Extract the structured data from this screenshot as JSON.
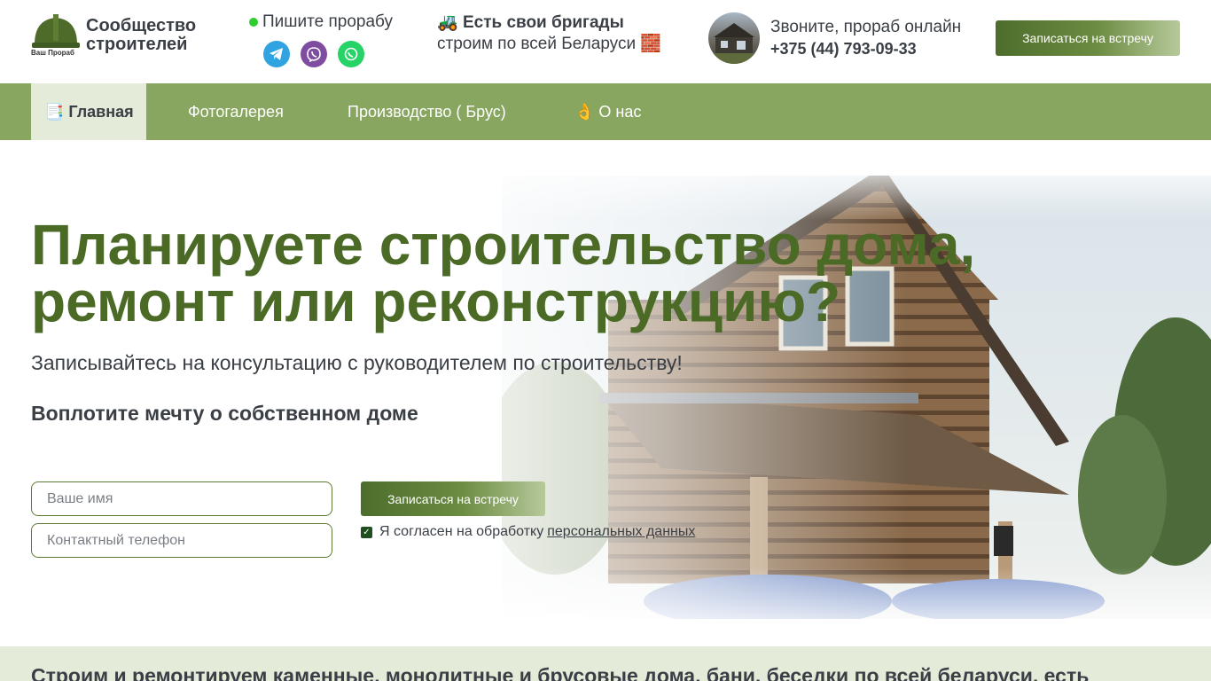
{
  "header": {
    "logo_caption": "Ваш Прораб",
    "brand_line1": "Сообщество",
    "brand_line2": "строителей",
    "write_label": "Пишите прорабу",
    "brigades_bold": "Есть свои бригады",
    "brigades_text": "строим по всей Беларуси",
    "call_label": "Звоните, прораб онлайн",
    "call_phone": "+375 (44) 793-09-33",
    "cta_label": "Записаться на встречу"
  },
  "nav": {
    "items": [
      {
        "label": "Главная",
        "emoji": "📑"
      },
      {
        "label": "Фотогалерея"
      },
      {
        "label": "Производство ( Брус)"
      },
      {
        "label": "О нас",
        "emoji": "👌"
      }
    ]
  },
  "hero": {
    "title": "Планируете строительство дома, ремонт или реконструкцию?",
    "subtitle": "Записывайтесь на консультацию с руководителем по строительству!",
    "dream": "Воплотите мечту о собственном доме",
    "name_placeholder": "Ваше имя",
    "phone_placeholder": "Контактный телефон",
    "cta_label": "Записаться на встречу",
    "agree_text": "Я согласен на обработку",
    "agree_link": "персональных данных"
  },
  "bottom": {
    "text": "Строим и ремонтируем каменные, монолитные и брусовые дома, бани, беседки по всей беларуси, есть"
  },
  "colors": {
    "nav_bg": "#88a660",
    "title_green": "#4a6a25",
    "active_nav_bg": "#e4ebd9",
    "strip_bg": "#e4ebd9"
  }
}
